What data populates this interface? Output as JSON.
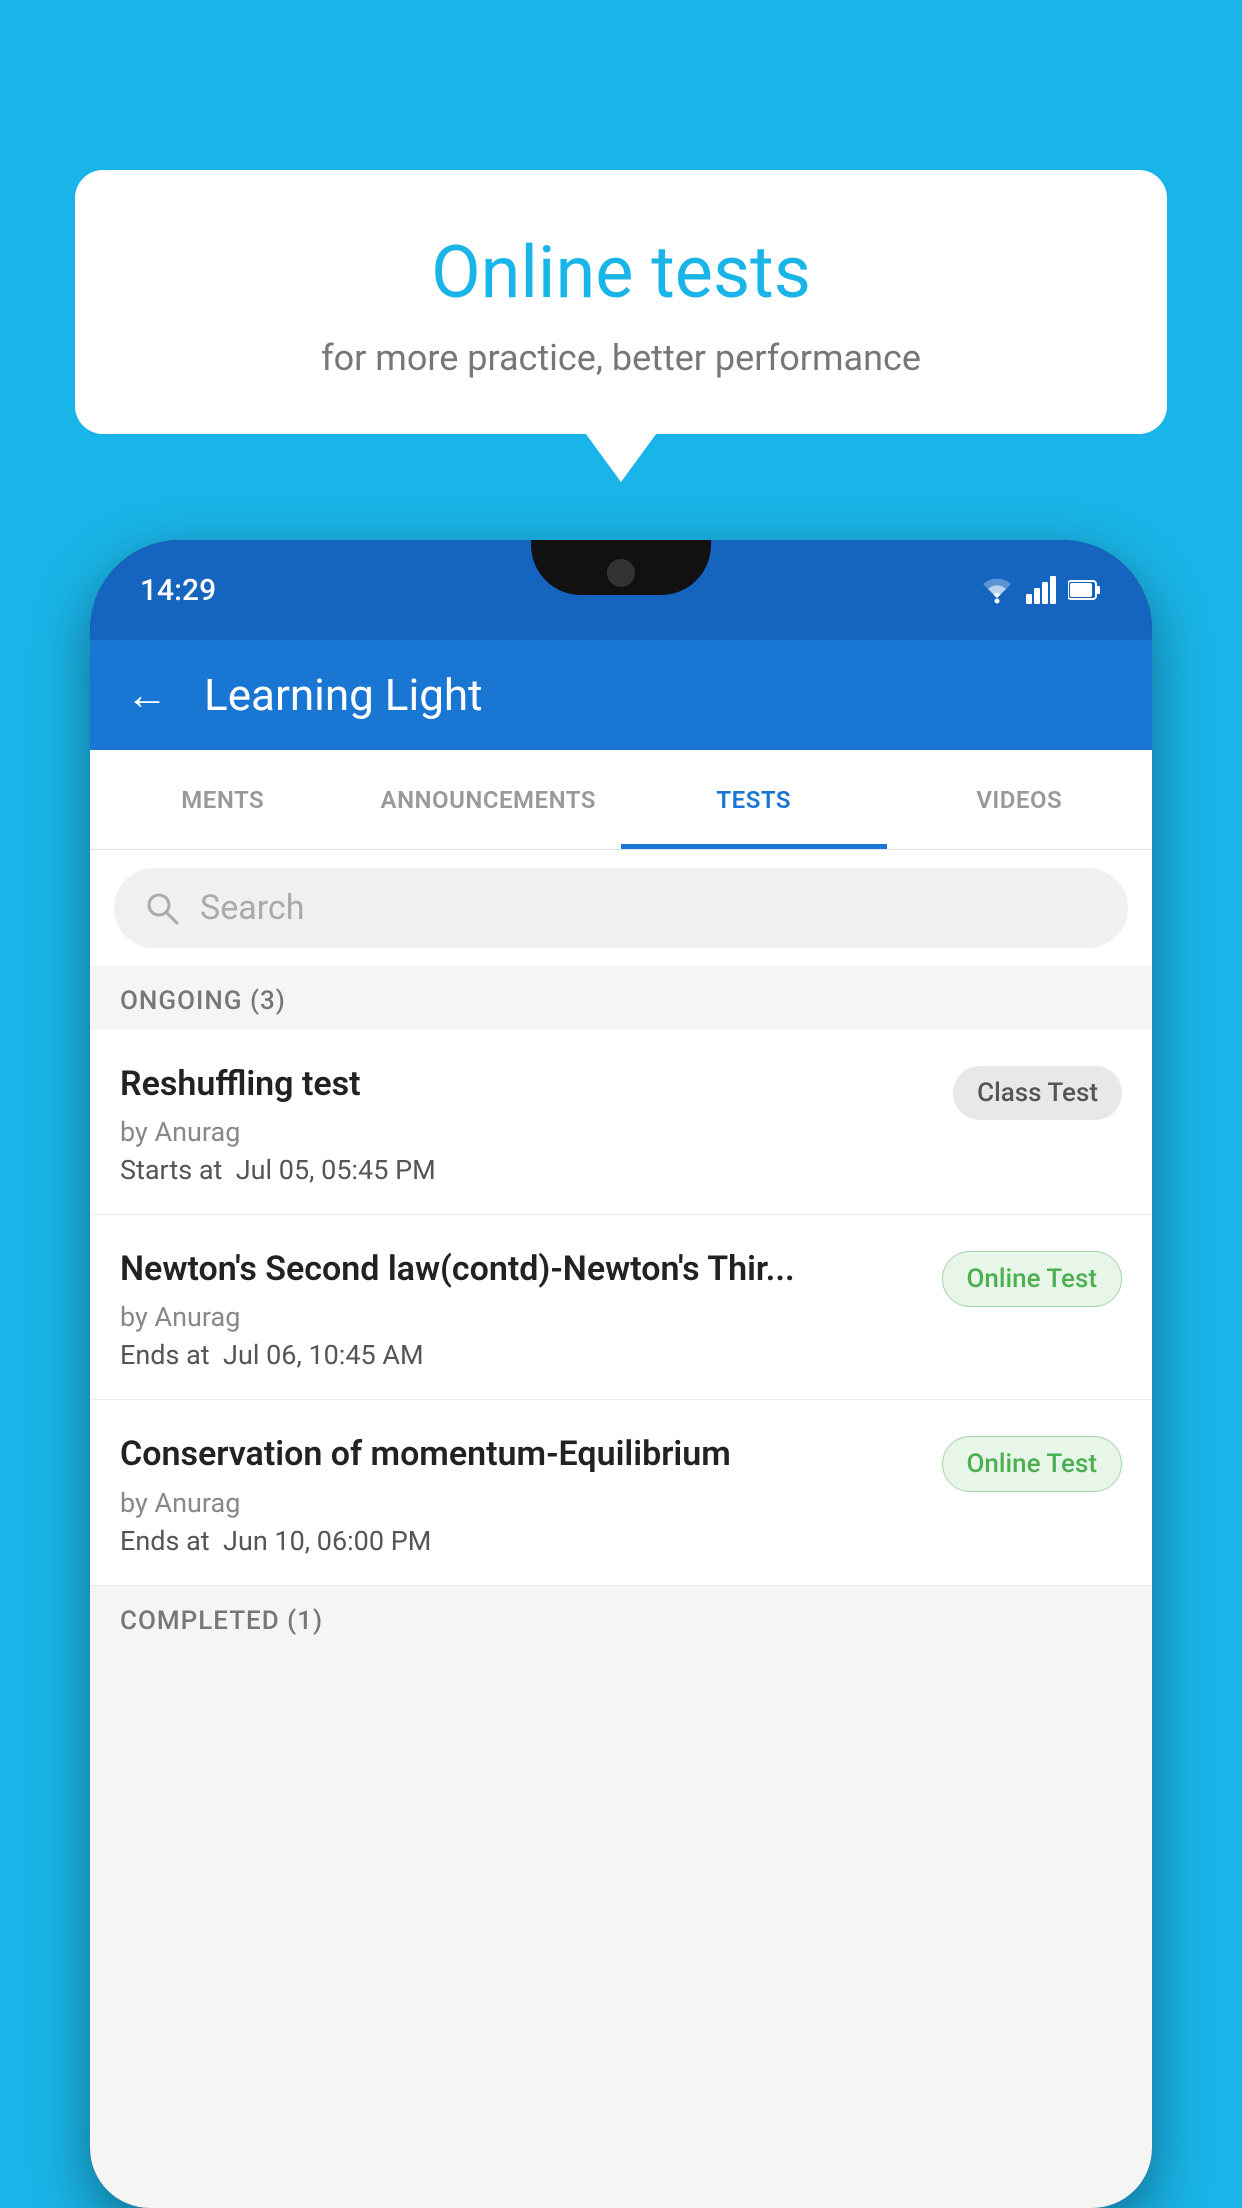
{
  "background_color": "#1ab5e8",
  "promo": {
    "title": "Online tests",
    "subtitle": "for more practice, better performance"
  },
  "phone": {
    "status_bar": {
      "time": "14:29",
      "icons": [
        "wifi",
        "signal",
        "battery"
      ]
    },
    "header": {
      "back_label": "←",
      "title": "Learning Light"
    },
    "tabs": [
      {
        "label": "MENTS",
        "active": false
      },
      {
        "label": "ANNOUNCEMENTS",
        "active": false
      },
      {
        "label": "TESTS",
        "active": true
      },
      {
        "label": "VIDEOS",
        "active": false
      }
    ],
    "search": {
      "placeholder": "Search"
    },
    "ongoing_section": {
      "label": "ONGOING (3)"
    },
    "tests": [
      {
        "name": "Reshuffling test",
        "by": "by Anurag",
        "date_label": "Starts at",
        "date": "Jul 05, 05:45 PM",
        "badge": "Class Test",
        "badge_type": "class"
      },
      {
        "name": "Newton's Second law(contd)-Newton's Thir...",
        "by": "by Anurag",
        "date_label": "Ends at",
        "date": "Jul 06, 10:45 AM",
        "badge": "Online Test",
        "badge_type": "online"
      },
      {
        "name": "Conservation of momentum-Equilibrium",
        "by": "by Anurag",
        "date_label": "Ends at",
        "date": "Jun 10, 06:00 PM",
        "badge": "Online Test",
        "badge_type": "online"
      }
    ],
    "completed_section": {
      "label": "COMPLETED (1)"
    }
  }
}
